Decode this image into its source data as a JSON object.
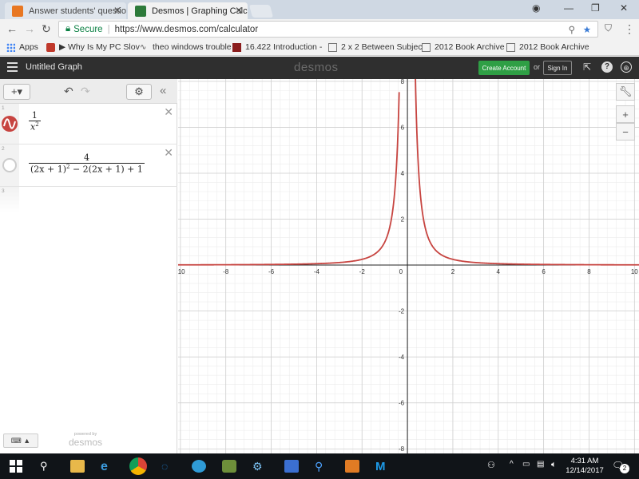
{
  "browser": {
    "tabs": [
      {
        "title": "Answer students' questio",
        "favicon": "chegg-icon",
        "color": "#e87722"
      },
      {
        "title": "Desmos | Graphing Calcu",
        "favicon": "desmos-icon",
        "color": "#2d7a3a"
      }
    ],
    "secure_label": "Secure",
    "url": "https://www.desmos.com/calculator",
    "bookmarks": [
      {
        "label": "Apps"
      },
      {
        "label": "▶ Why Is My PC Slov"
      },
      {
        "label": "theo windows trouble"
      },
      {
        "label": "16.422 Introduction -"
      },
      {
        "label": "2 x 2 Between Subjec"
      },
      {
        "label": "2012 Book Archive"
      },
      {
        "label": "2012 Book Archive"
      }
    ]
  },
  "desmos": {
    "graph_title": "Untitled Graph",
    "logo": "desmos",
    "create_account": "Create Account",
    "or": "or",
    "sign_in": "Sign In",
    "expressions": [
      {
        "index": "1",
        "numerator": "1",
        "denominator": "x",
        "denominator_exp": "2",
        "color": "#c74440",
        "active": true
      },
      {
        "index": "2",
        "numerator": "4",
        "denominator": "(2x + 1)",
        "denominator_exp": "2",
        "denominator_rest": " − 2(2x + 1) + 1",
        "active": false
      },
      {
        "index": "3"
      }
    ],
    "powered_by": "powered by",
    "powered_logo": "desmos"
  },
  "chart_data": {
    "type": "line",
    "title": "",
    "xlabel": "",
    "ylabel": "",
    "xlim": [
      -10.1,
      10.2
    ],
    "ylim": [
      -8.2,
      8.1
    ],
    "grid": true,
    "x_ticks": [
      -10,
      -8,
      -6,
      -4,
      -2,
      0,
      2,
      4,
      6,
      8,
      10
    ],
    "y_ticks": [
      -8,
      -6,
      -4,
      -2,
      2,
      4,
      6,
      8
    ],
    "series": [
      {
        "expression": "1/x^2",
        "color": "#c74440"
      }
    ]
  },
  "taskbar": {
    "time": "4:31 AM",
    "date": "12/14/2017",
    "notifications": "2"
  }
}
